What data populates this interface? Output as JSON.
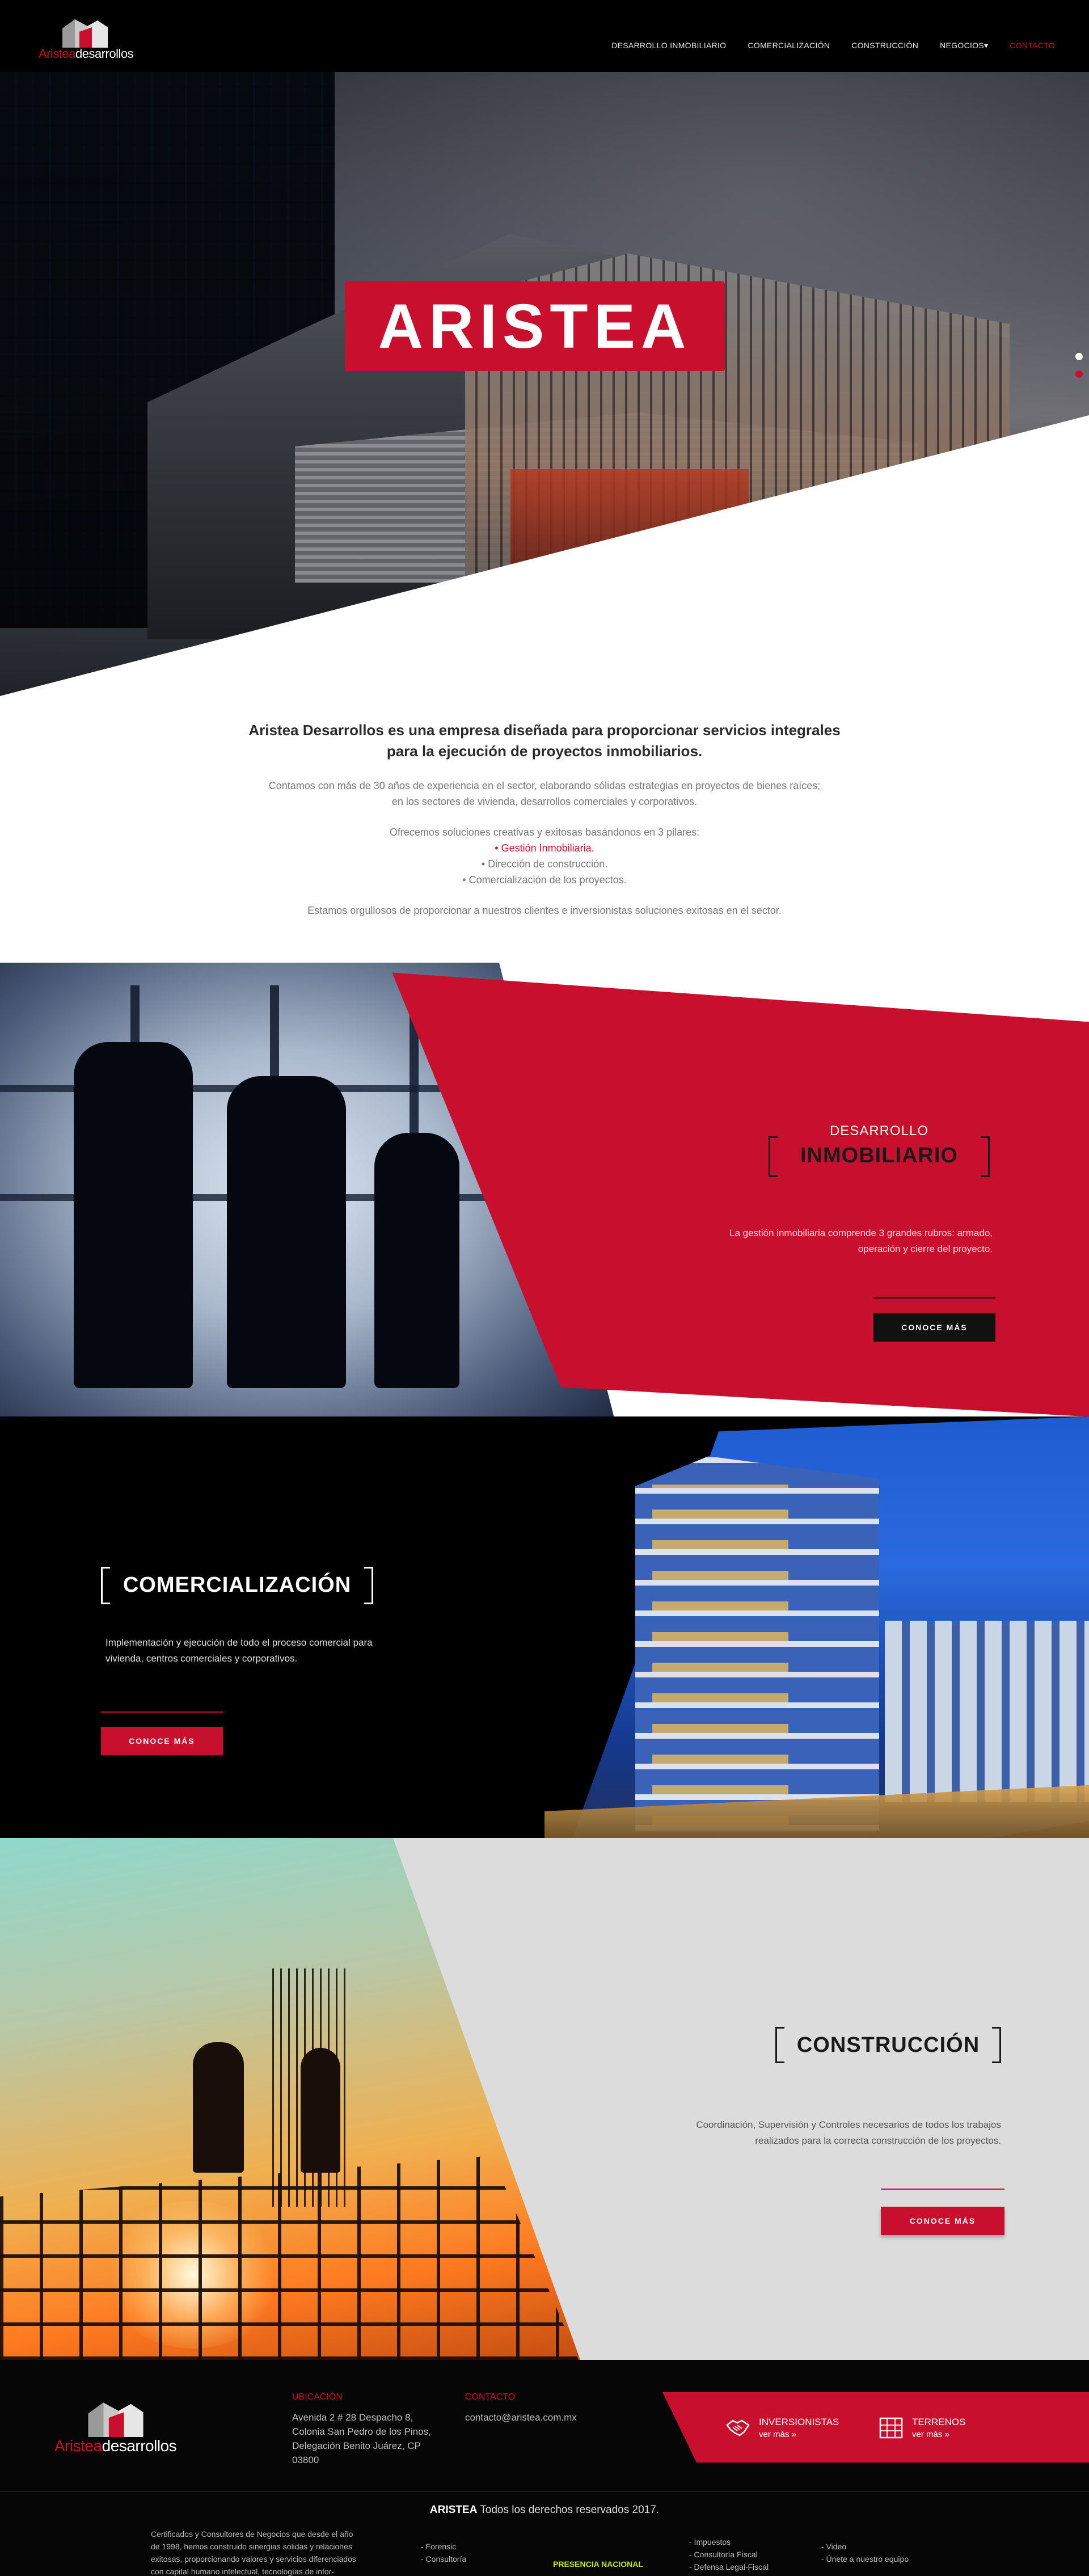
{
  "brand": {
    "name_part1": "Aristea",
    "name_part2": "desarrollos",
    "accent": "#c8102e"
  },
  "nav": {
    "items": [
      {
        "label": "DESARROLLO INMOBILIARIO",
        "active": false
      },
      {
        "label": "COMERCIALIZACIÓN",
        "active": false
      },
      {
        "label": "CONSTRUCCIÓN",
        "active": false
      },
      {
        "label": "NEGOCIOS▾",
        "active": false
      },
      {
        "label": "CONTACTO",
        "active": true
      }
    ]
  },
  "hero": {
    "title": "ARISTEA",
    "slides": 2,
    "active_slide": 2
  },
  "intro": {
    "lead": "Aristea Desarrollos es una empresa diseñada para proporcionar servicios integrales para la ejecución de proyectos inmobiliarios.",
    "p1_line1": "Contamos con más de 30 años de experiencia en el sector, elaborando sólidas estrategias en proyectos de bienes raíces;",
    "p1_line2": "en los sectores de vivienda, desarrollos comerciales y corporativos.",
    "pillars_intro": "Ofrecemos soluciones creativas y exitosas basándonos en 3 pilares:",
    "pillars": [
      "• Gestión Inmobiliaria.",
      "• Dirección de construcción.",
      "• Comercialización de los proyectos."
    ],
    "closing": "Estamos orgullosos de proporcionar a nuestros clientes e inversionistas soluciones exitosas en el sector."
  },
  "services": {
    "desarrollo": {
      "kicker": "DESARROLLO",
      "title": "INMOBILIARIO",
      "desc_line1": "La gestión inmobiliaria comprende 3 grandes rubros: armado,",
      "desc_line2": "operación y cierre del proyecto.",
      "button": "CONOCE MÁS"
    },
    "comercializacion": {
      "title": "COMERCIALIZACIÓN",
      "desc_line1": "Implementación y ejecución de todo el proceso comercial para",
      "desc_line2": "vivienda, centros comerciales y corporativos.",
      "button": "CONOCE MÁS"
    },
    "construccion": {
      "title": "CONSTRUCCIÓN",
      "desc_line1": "Coordinación, Supervisión y Controles necesarios de todos los trabajos",
      "desc_line2": "realizados para la correcta construcción de los proyectos.",
      "button": "CONOCE MÁS"
    }
  },
  "footer": {
    "ubicacion_heading": "UBICACIÓN",
    "address": [
      "Avenida 2 # 28 Despacho 8,",
      "Colonia San Pedro de los Pinos,",
      "Delegación Benito Juárez, CP",
      "03800"
    ],
    "contacto_heading": "CONTACTO",
    "email": "contacto@aristea.com.mx",
    "inversionistas": {
      "label": "INVERSIONISTAS",
      "link": "ver más »",
      "icon": "handshake-icon"
    },
    "terrenos": {
      "label": "TERRENOS",
      "link": "ver más »",
      "icon": "map-plot-icon"
    },
    "copyright_brand": "ARISTEA",
    "copyright_text": " Todos los derechos reservados 2017.",
    "overflow_text": [
      "Certificados y Consultores de Negocios que desde el año",
      "de 1998, hemos construido sinergias sólidas y relaciones",
      "exitosas, proporcionando valores y servicios diferenciados",
      "con capital humano intelectual, tecnologías de infor-"
    ],
    "overflow_col2": [
      "- Forensic",
      "- Consultoría"
    ],
    "overflow_hi": "PRESENCIA NACIONAL",
    "overflow_col3": [
      "- Impuestos",
      "- Consultoría Fiscal",
      "- Defensa Legal-Fiscal"
    ],
    "overflow_col4": [
      "- Video",
      "- Únete a nuestro equipo"
    ]
  }
}
